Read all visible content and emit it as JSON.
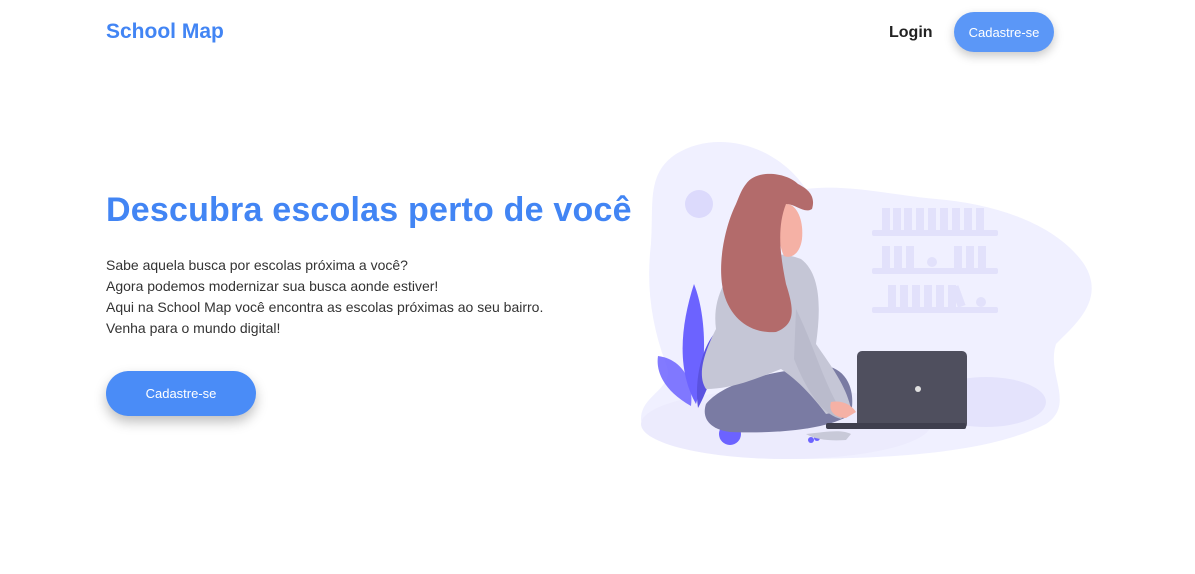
{
  "header": {
    "brand": "School Map",
    "login_label": "Login",
    "signup_label": "Cadastre-se"
  },
  "hero": {
    "title": "Descubra escolas perto de você",
    "lines": [
      "Sabe aquela busca por escolas próxima a você?",
      "Agora podemos modernizar sua busca aonde estiver!",
      "Aqui na School Map você encontra as escolas próximas ao seu bairro. Venha para o mundo digital!"
    ],
    "cta_label": "Cadastre-se"
  },
  "colors": {
    "accent": "#4285f4",
    "button": "#4a8cf7",
    "illustration_bg": "#f0f0ff",
    "illustration_accent": "#6c63ff"
  },
  "illustration": {
    "icon": "woman-laptop-illustration"
  }
}
